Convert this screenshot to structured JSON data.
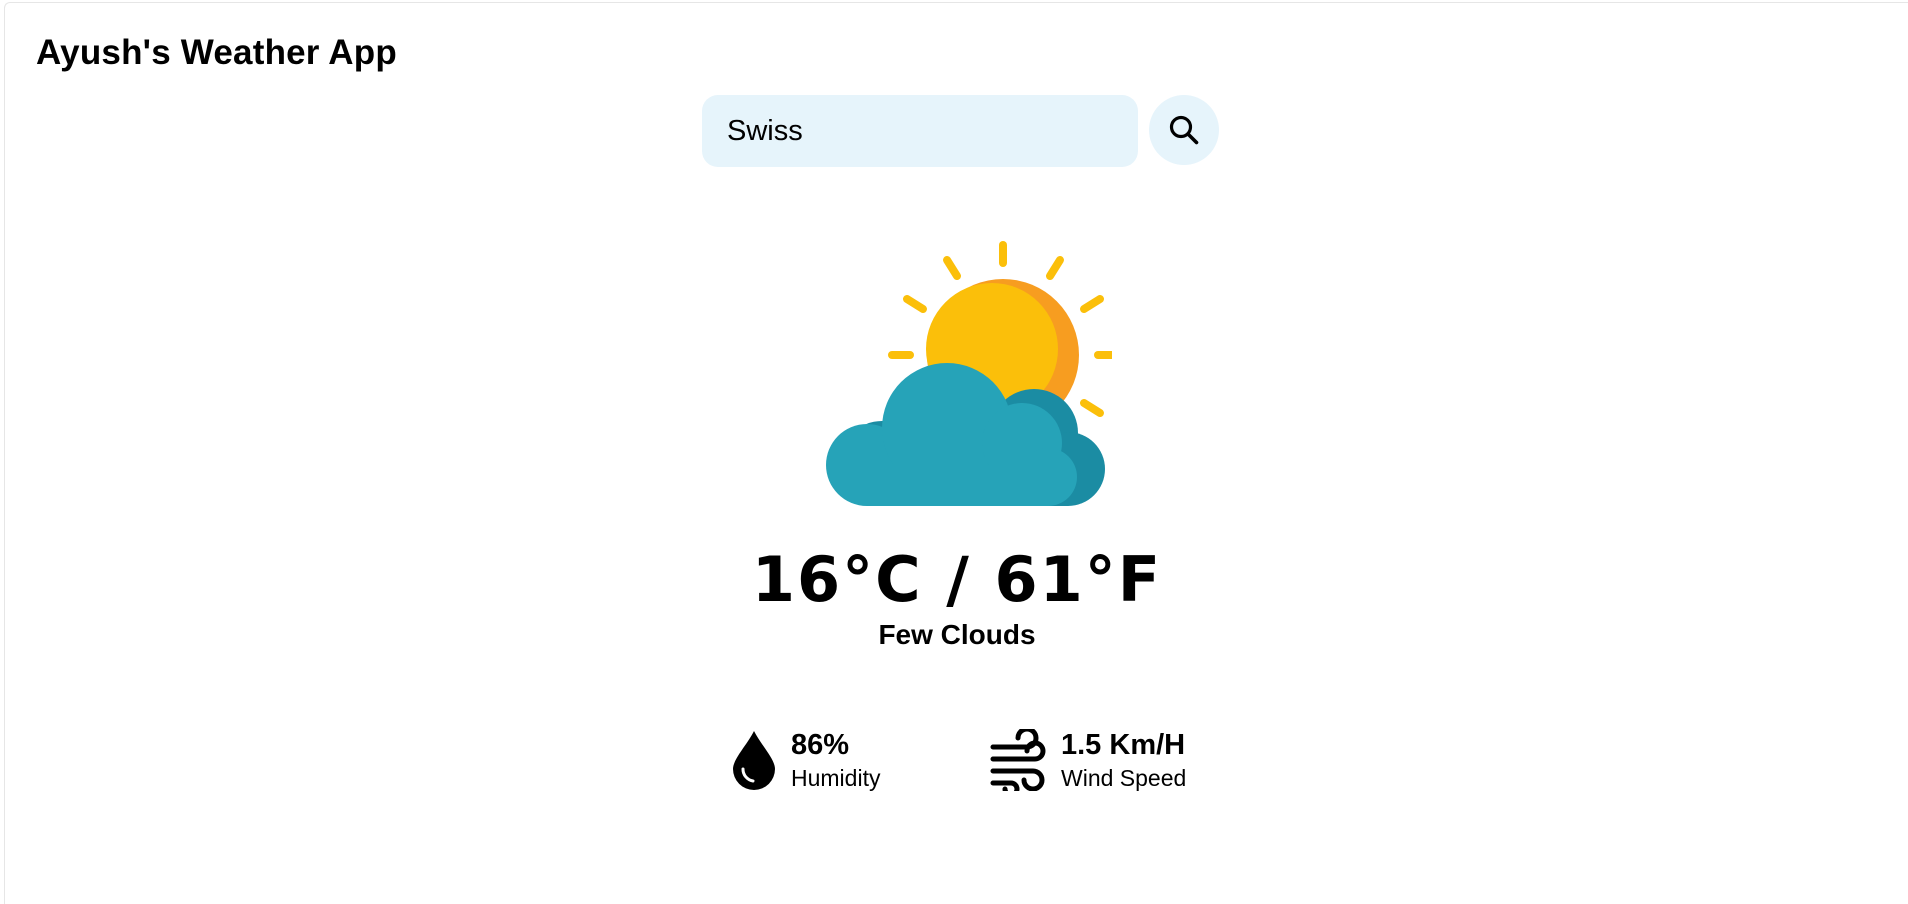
{
  "app": {
    "title": "Ayush's Weather App"
  },
  "search": {
    "value": "Swiss",
    "icon": "search-icon"
  },
  "weather": {
    "icon": "sun-behind-cloud-icon",
    "temperature": "16°C / 61°F",
    "description": "Few Clouds"
  },
  "stats": {
    "humidity": {
      "icon": "water-drop-icon",
      "value": "86%",
      "label": "Humidity"
    },
    "wind": {
      "icon": "wind-icon",
      "value": "1.5 Km/H",
      "label": "Wind Speed"
    }
  },
  "colors": {
    "search_bg": "#e6f4fb",
    "sun": "#fbbf0a",
    "sun_shade": "#f79d20",
    "cloud": "#26a3b8",
    "cloud_shade": "#1b8ca3"
  }
}
